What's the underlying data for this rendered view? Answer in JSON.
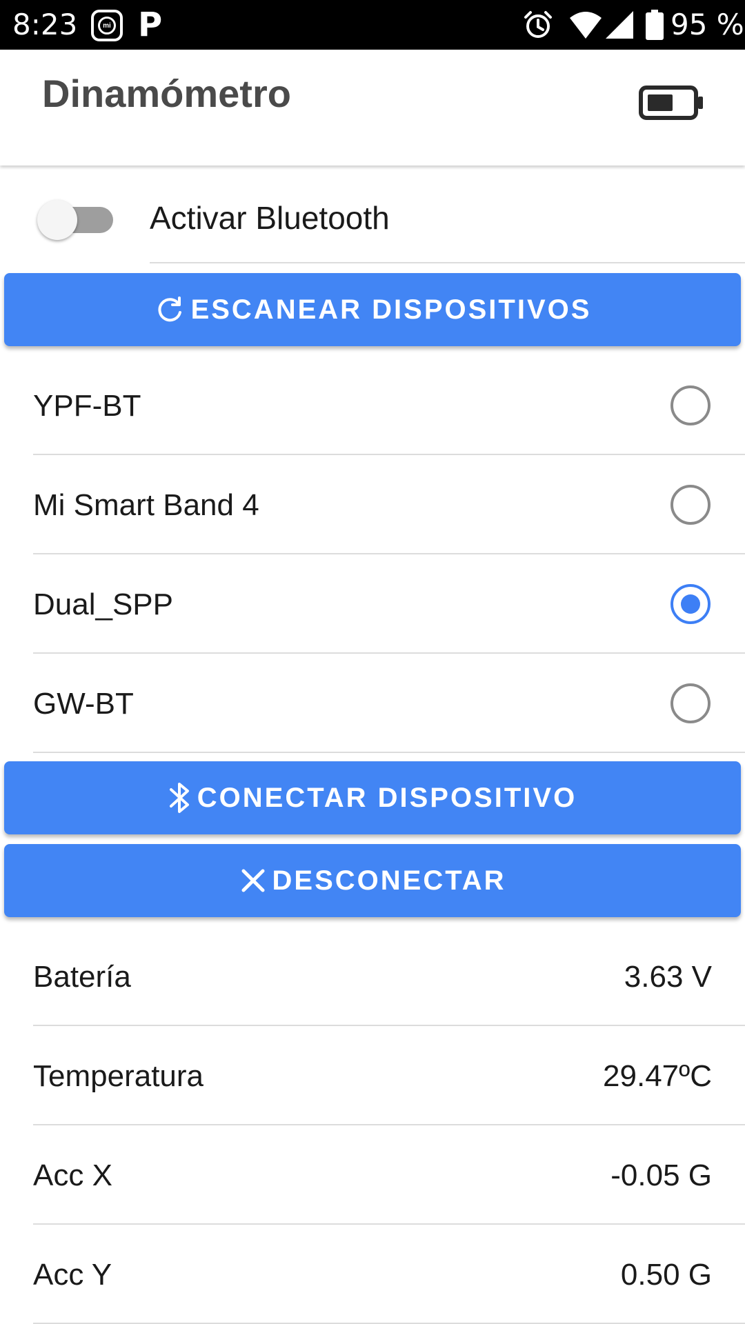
{
  "status_bar": {
    "time": "8:23",
    "mi_logo": "mi",
    "app_icon_letter": "P",
    "battery_percent": "95 %",
    "icons": [
      "mi-app-icon",
      "parking-icon",
      "alarm-icon",
      "wifi-icon",
      "signal-icon",
      "battery-icon"
    ]
  },
  "app_bar": {
    "title": "Dinamómetro",
    "icon": "battery-icon"
  },
  "bluetooth": {
    "label": "Activar Bluetooth",
    "enabled": false
  },
  "scan_button": {
    "label": "ESCANEAR DISPOSITIVOS",
    "icon": "refresh-icon"
  },
  "devices": [
    {
      "name": "YPF-BT",
      "selected": false
    },
    {
      "name": "Mi Smart Band 4",
      "selected": false
    },
    {
      "name": "Dual_SPP",
      "selected": true
    },
    {
      "name": "GW-BT",
      "selected": false
    }
  ],
  "connect_button": {
    "label": "CONECTAR DISPOSITIVO",
    "icon": "bluetooth-icon"
  },
  "disconnect_button": {
    "label": "DESCONECTAR",
    "icon": "close-icon"
  },
  "readings": [
    {
      "label": "Batería",
      "value": "3.63 V"
    },
    {
      "label": "Temperatura",
      "value": "29.47ºC"
    },
    {
      "label": "Acc X",
      "value": "-0.05 G"
    },
    {
      "label": "Acc Y",
      "value": "0.50 G"
    }
  ],
  "colors": {
    "primary": "#4285f4",
    "radio_selected": "#3d7ff5",
    "status_bar": "#000000",
    "title_text": "#4a4a4a"
  }
}
